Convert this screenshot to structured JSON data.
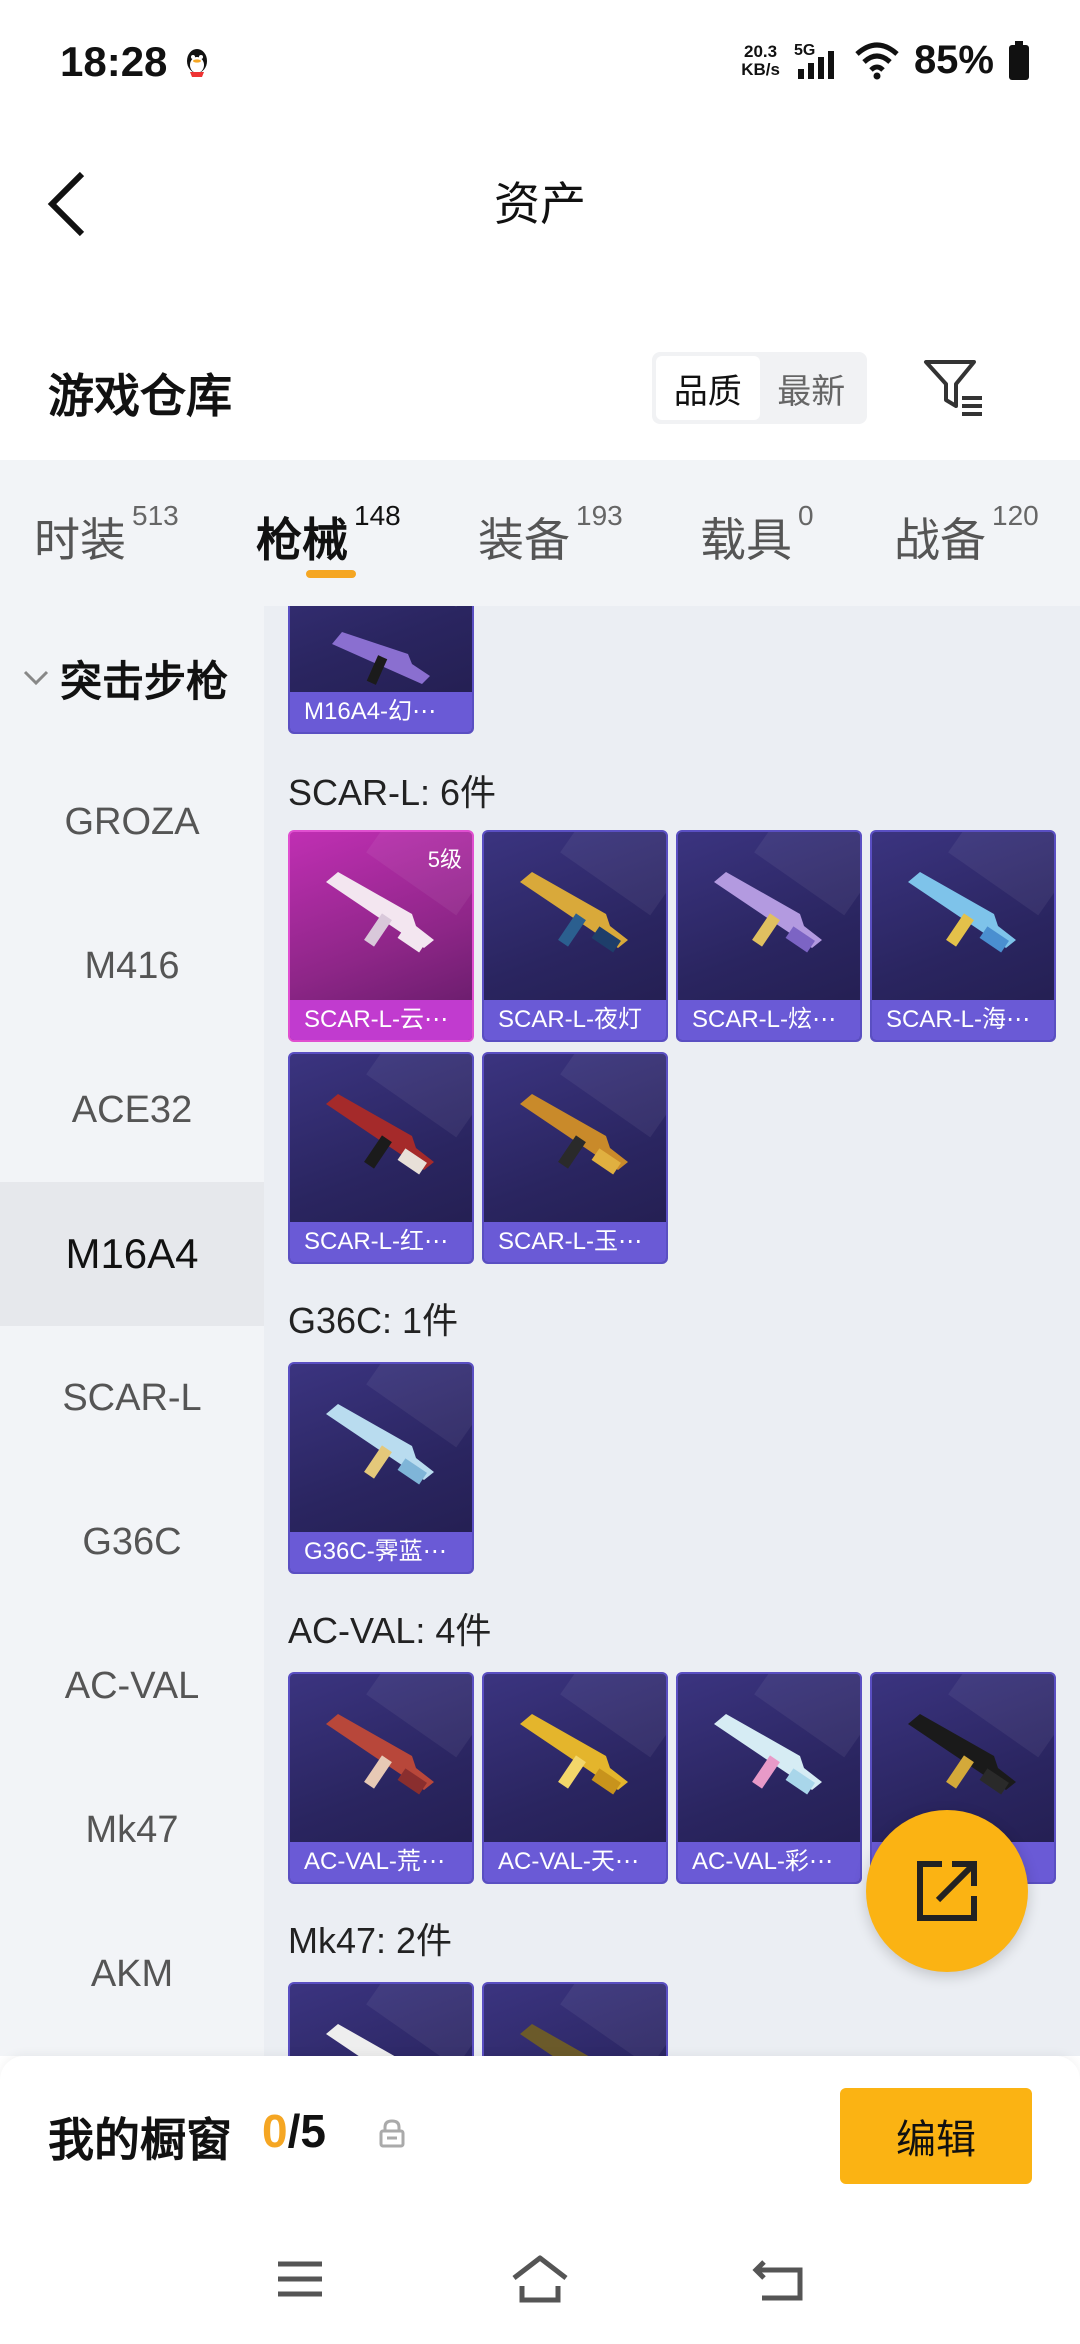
{
  "status_bar": {
    "time": "18:28",
    "speed_value": "20.3",
    "speed_unit": "KB/s",
    "network": "5G",
    "battery": "85%"
  },
  "header": {
    "title": "资产"
  },
  "warehouse": {
    "title": "游戏仓库",
    "sort_options": [
      "品质",
      "最新"
    ],
    "sort_active": "品质"
  },
  "tabs": [
    {
      "label": "时装",
      "count": "513"
    },
    {
      "label": "枪械",
      "count": "148",
      "active": true
    },
    {
      "label": "装备",
      "count": "193"
    },
    {
      "label": "载具",
      "count": "0"
    },
    {
      "label": "战备",
      "count": "120"
    }
  ],
  "sidebar": {
    "group": "突击步枪",
    "items": [
      "GROZA",
      "M416",
      "ACE32",
      "M16A4",
      "SCAR-L",
      "G36C",
      "AC-VAL",
      "Mk47",
      "AKM"
    ],
    "active": "M16A4"
  },
  "content": {
    "m16_card_label": "M16A4-幻⋯",
    "sections": [
      {
        "title": "SCAR-L: 6件",
        "cards": [
          {
            "label": "SCAR-L-云⋯",
            "badge": "5级"
          },
          {
            "label": "SCAR-L-夜灯"
          },
          {
            "label": "SCAR-L-炫⋯"
          },
          {
            "label": "SCAR-L-海⋯"
          },
          {
            "label": "SCAR-L-红⋯"
          },
          {
            "label": "SCAR-L-玉⋯"
          }
        ]
      },
      {
        "title": "G36C: 1件",
        "cards": [
          {
            "label": "G36C-霁蓝⋯"
          }
        ]
      },
      {
        "title": "AC-VAL: 4件",
        "cards": [
          {
            "label": "AC-VAL-荒⋯"
          },
          {
            "label": "AC-VAL-天⋯"
          },
          {
            "label": "AC-VAL-彩⋯"
          },
          {
            "label": ""
          }
        ]
      },
      {
        "title": "Mk47: 2件",
        "cards": []
      }
    ]
  },
  "bottom": {
    "showcase_label": "我的橱窗",
    "showcase_current": "0",
    "showcase_total": "/5",
    "edit_label": "编辑"
  },
  "colors": {
    "accent": "#fbb313",
    "card_purple": "#2a2560",
    "card_pink": "#8e2688"
  }
}
